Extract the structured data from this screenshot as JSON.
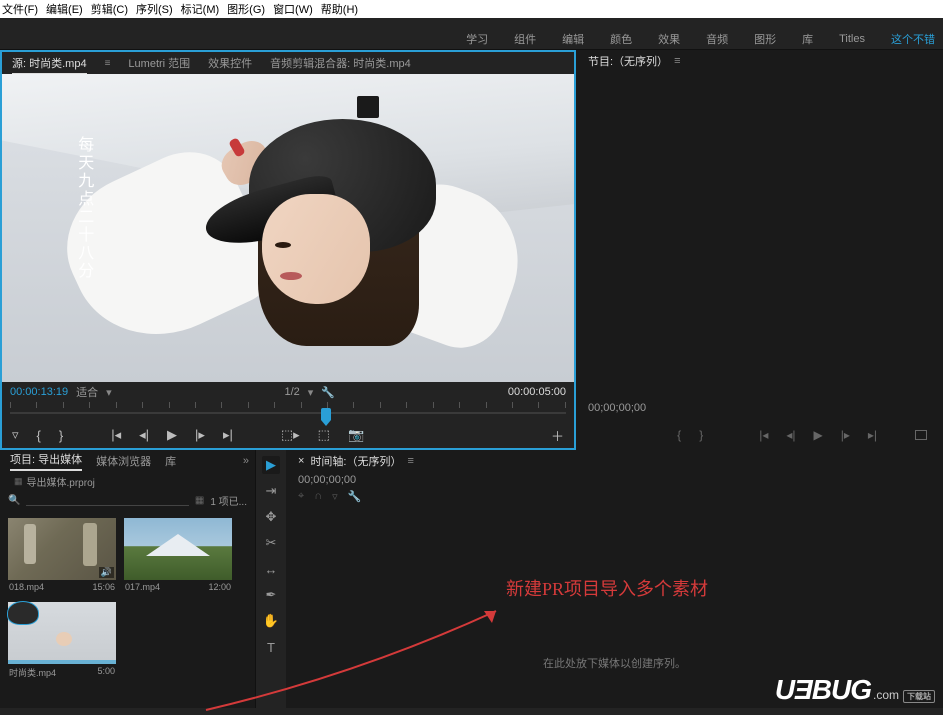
{
  "menubar": {
    "file": "文件(F)",
    "edit": "编辑(E)",
    "clip": "剪辑(C)",
    "sequence": "序列(S)",
    "markers": "标记(M)",
    "graphics": "图形(G)",
    "window": "窗口(W)",
    "help": "帮助(H)"
  },
  "workspaces": {
    "learn": "学习",
    "assembly": "组件",
    "editing": "编辑",
    "color": "颜色",
    "effects": "效果",
    "audio": "音频",
    "graphics": "图形",
    "library": "库",
    "titles": "Titles",
    "custom": "这个不错"
  },
  "source": {
    "tab_source": "源: 时尚类.mp4",
    "tab_lumetri": "Lumetri 范围",
    "tab_effectctrl": "效果控件",
    "tab_audiomix": "音频剪辑混合器: 时尚类.mp4",
    "overlay_text": "每天九点二十八分",
    "in_tc": "00:00:13:19",
    "fit": "适合",
    "ratio": "1/2",
    "out_tc": "00:00:05:00"
  },
  "program": {
    "title": "节目:（无序列）",
    "menu_glyph": "≡",
    "tc": "00;00;00;00"
  },
  "project": {
    "tab_project": "项目: 导出媒体",
    "tab_browser": "媒体浏览器",
    "tab_library": "库",
    "name": "导出媒体.prproj",
    "search_placeholder": " ",
    "item_count": "1 项已...",
    "clips": [
      {
        "name": "018.mp4",
        "dur": "15:06"
      },
      {
        "name": "017.mp4",
        "dur": "12:00"
      },
      {
        "name": "时尚类.mp4",
        "dur": "5:00"
      }
    ]
  },
  "timeline": {
    "title": "时间轴:（无序列）",
    "menu_glyph": "≡",
    "tc": "00;00;00;00",
    "empty_text": "在此处放下媒体以创建序列。"
  },
  "annotation": {
    "text": "新建PR项目导入多个素材"
  },
  "watermark": {
    "brand": "UƎBUG",
    "dotcom": ".com",
    "tag": "下载站"
  }
}
